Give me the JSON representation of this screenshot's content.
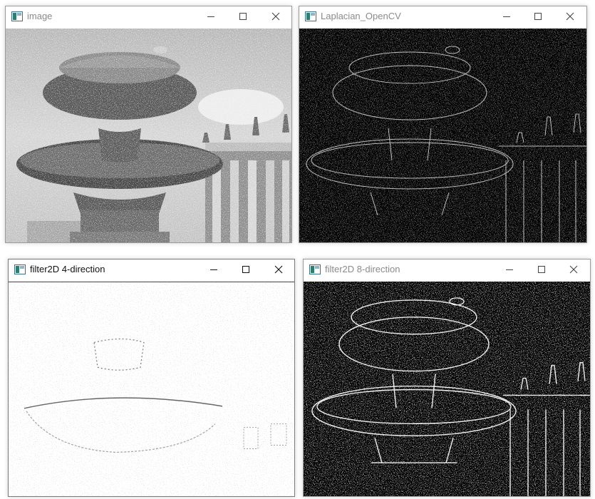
{
  "windows": [
    {
      "id": "image",
      "title": "image",
      "active": false,
      "icon": "opencv-window-icon"
    },
    {
      "id": "laplacian",
      "title": "Laplacian_OpenCV",
      "active": false,
      "icon": "opencv-window-icon"
    },
    {
      "id": "filter4",
      "title": "filter2D 4-direction",
      "active": true,
      "icon": "opencv-window-icon"
    },
    {
      "id": "filter8",
      "title": "filter2D 8-direction",
      "active": false,
      "icon": "opencv-window-icon"
    }
  ],
  "controls": {
    "minimize": "minimize-icon",
    "maximize": "maximize-icon",
    "close": "close-icon"
  },
  "images": {
    "image": "grayscale photo of a stone fountain with a pigeon in front of a colonnade with statues",
    "laplacian": "Laplacian edge map (white edges on black)",
    "filter4": "4-direction filter2D result (mostly white with faint gray detail)",
    "filter8": "8-direction filter2D edge map (white edges on black)"
  },
  "colors": {
    "title_inactive": "#8a8a8a",
    "title_active": "#111111",
    "border": "#9a9a9a"
  }
}
